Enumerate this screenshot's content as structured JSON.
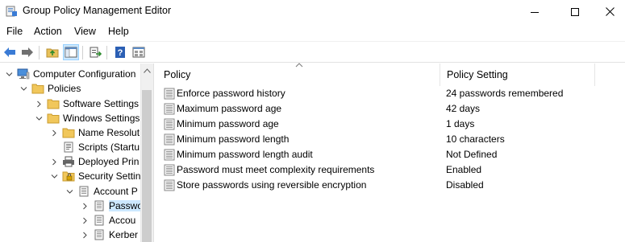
{
  "window": {
    "title": "Group Policy Management Editor"
  },
  "menu": [
    "File",
    "Action",
    "View",
    "Help"
  ],
  "toolbar": {
    "buttons": [
      "back-icon",
      "forward-icon",
      "up-folder-icon",
      "show-hide-tree-icon",
      "export-list-icon",
      "help-icon",
      "properties-icon"
    ]
  },
  "tree": {
    "items": [
      {
        "label": "Computer Configuration",
        "expanded": true
      },
      {
        "label": "Policies",
        "expanded": true
      },
      {
        "label": "Software Settings",
        "expanded": false
      },
      {
        "label": "Windows Settings",
        "expanded": true
      },
      {
        "label": "Name Resolut",
        "expanded": false
      },
      {
        "label": "Scripts (Startu",
        "expanded": null
      },
      {
        "label": "Deployed Prin",
        "expanded": false
      },
      {
        "label": "Security Settin",
        "expanded": true
      },
      {
        "label": "Account P",
        "expanded": true
      },
      {
        "label": "Passwo",
        "expanded": false,
        "selected": true
      },
      {
        "label": "Accou",
        "expanded": false
      },
      {
        "label": "Kerber",
        "expanded": false
      }
    ]
  },
  "list": {
    "columns": {
      "policy": "Policy",
      "setting": "Policy Setting"
    },
    "rows": [
      {
        "policy": "Enforce password history",
        "setting": "24 passwords remembered"
      },
      {
        "policy": "Maximum password age",
        "setting": "42 days"
      },
      {
        "policy": "Minimum password age",
        "setting": "1 days"
      },
      {
        "policy": "Minimum password length",
        "setting": "10 characters"
      },
      {
        "policy": "Minimum password length audit",
        "setting": "Not Defined"
      },
      {
        "policy": "Password must meet complexity requirements",
        "setting": "Enabled"
      },
      {
        "policy": "Store passwords using reversible encryption",
        "setting": "Disabled"
      }
    ]
  },
  "colors": {
    "selection": "#cce8ff",
    "accent": "#0078d7"
  }
}
